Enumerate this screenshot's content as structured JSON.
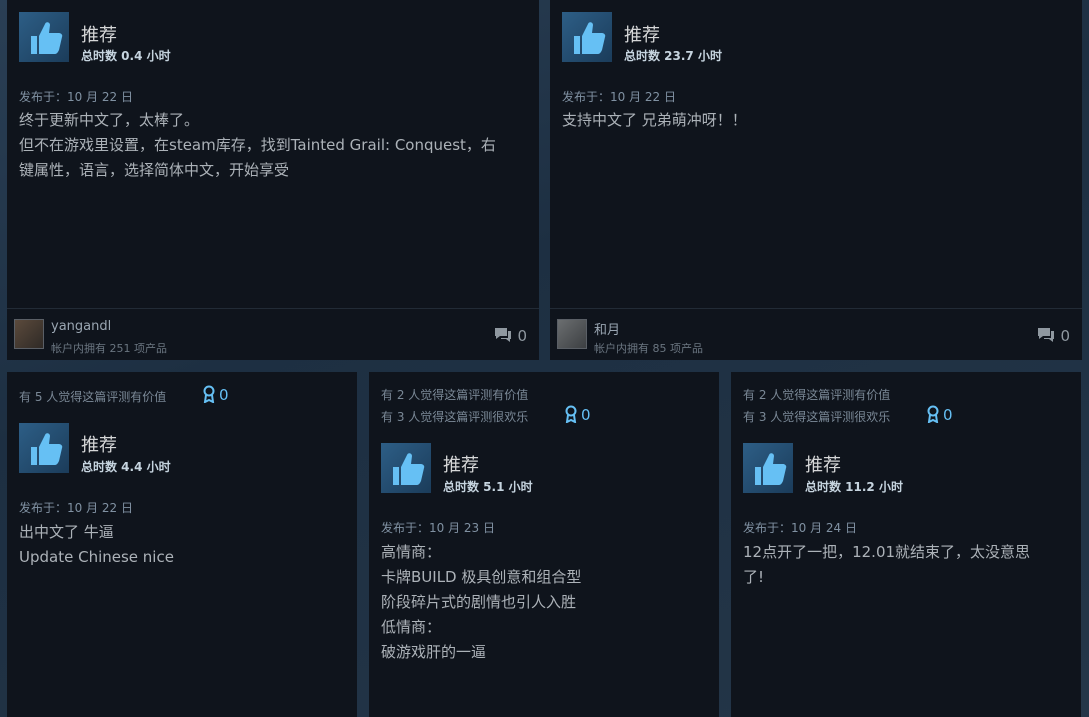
{
  "reviews": [
    {
      "rec_label": "推荐",
      "hours": "总时数 0.4 小时",
      "posted": "发布于：10 月 22 日",
      "lines": [
        "终于更新中文了，太棒了。",
        "但不在游戏里设置，在steam库存，找到Tainted Grail: Conquest，右",
        "键属性，语言，选择简体中文，开始享受"
      ],
      "author": "yangandl",
      "owned": "帐户内拥有 251 项产品",
      "comments": "0"
    },
    {
      "rec_label": "推荐",
      "hours": "总时数 23.7 小时",
      "posted": "发布于：10 月 22 日",
      "lines": [
        "支持中文了 兄弟萌冲呀！！"
      ],
      "author": "和月",
      "owned": "帐户内拥有 85 项产品",
      "comments": "0"
    },
    {
      "helpful": [
        "有 5 人觉得这篇评测有价值"
      ],
      "awards": "0",
      "rec_label": "推荐",
      "hours": "总时数 4.4 小时",
      "posted": "发布于：10 月 22 日",
      "lines": [
        "出中文了 牛逼",
        "Update Chinese nice"
      ]
    },
    {
      "helpful": [
        "有 2 人觉得这篇评测有价值",
        "有 3 人觉得这篇评测很欢乐"
      ],
      "awards": "0",
      "rec_label": "推荐",
      "hours": "总时数 5.1 小时",
      "posted": "发布于：10 月 23 日",
      "lines": [
        "高情商：",
        "卡牌BUILD 极具创意和组合型",
        "阶段碎片式的剧情也引人入胜",
        "低情商：",
        "破游戏肝的一逼"
      ]
    },
    {
      "helpful": [
        "有 2 人觉得这篇评测有价值",
        "有 3 人觉得这篇评测很欢乐"
      ],
      "awards": "0",
      "rec_label": "推荐",
      "hours": "总时数 11.2 小时",
      "posted": "发布于：10 月 24 日",
      "lines": [
        "12点开了一把，12.01就结束了，太没意思",
        "了!"
      ]
    }
  ],
  "colors": {
    "card_bg": "#0f141c",
    "thumb_bg": "#2d5e86",
    "accent": "#66c0f4"
  },
  "icons": [
    "thumbs-up-icon",
    "comment-icon",
    "award-icon"
  ]
}
